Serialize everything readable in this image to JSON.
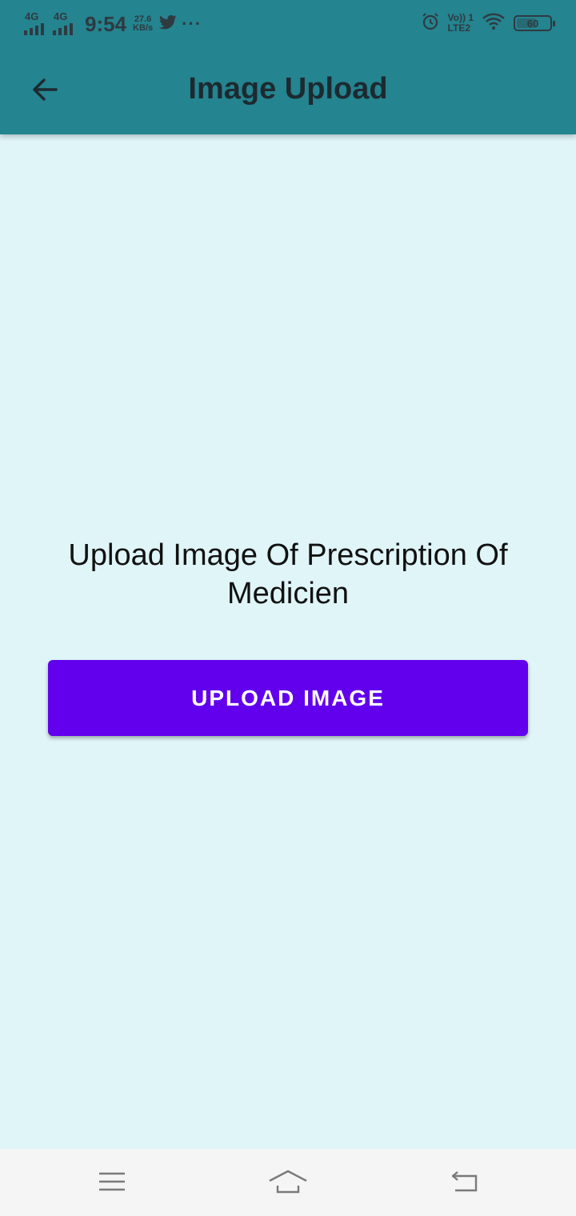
{
  "status_bar": {
    "network1": "4G",
    "network2": "4G",
    "time": "9:54",
    "speed_value": "27.6",
    "speed_unit": "KB/s",
    "more": "···",
    "volte_line1": "Vo)) 1",
    "volte_line2": "LTE2",
    "battery_level": "60",
    "icons": [
      "twitter-icon",
      "alarm-icon",
      "wifi-icon",
      "battery-icon"
    ]
  },
  "app_bar": {
    "title": "Image Upload",
    "back_icon": "arrow-left-icon",
    "background": "#248490"
  },
  "main": {
    "prompt": "Upload Image Of Prescription Of Medicien",
    "upload_button": "UPLOAD IMAGE",
    "button_color": "#6200ee",
    "background": "#dff5f8"
  },
  "nav_bar": {
    "items": [
      "menu-icon",
      "home-icon",
      "back-icon"
    ]
  }
}
